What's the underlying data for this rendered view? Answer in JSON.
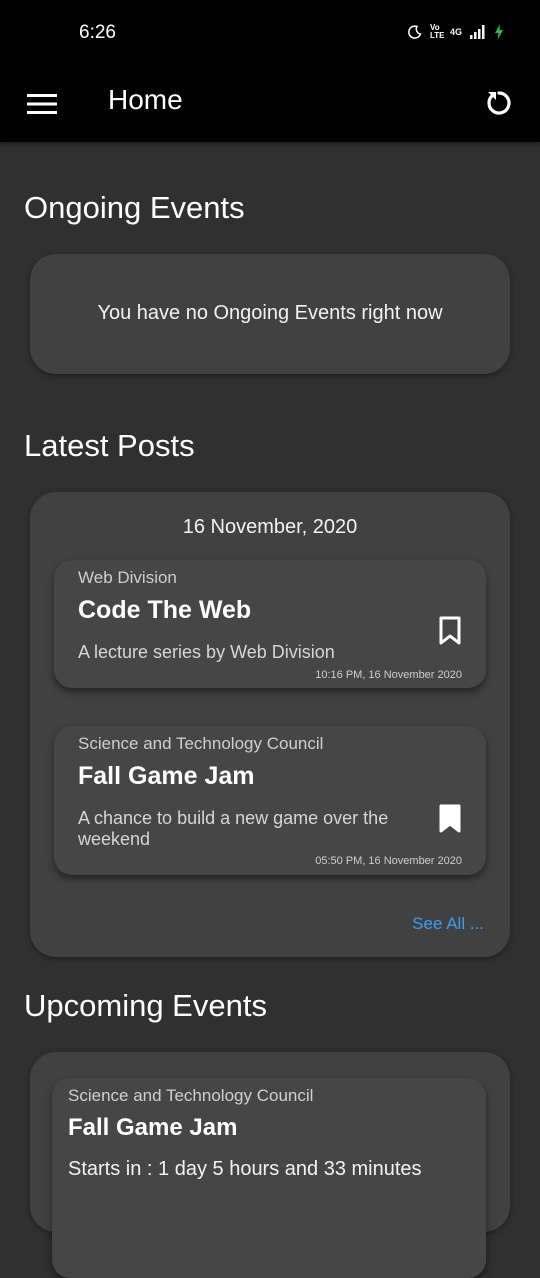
{
  "status_bar": {
    "time": "6:26",
    "network_label": "4G",
    "volte_label": "Vo LTE"
  },
  "app_bar": {
    "title": "Home",
    "menu_icon": "hamburger-menu-icon",
    "refresh_icon": "refresh-icon"
  },
  "ongoing": {
    "heading": "Ongoing Events",
    "empty_message": "You have no Ongoing Events right now"
  },
  "latest_posts": {
    "heading": "Latest Posts",
    "date": "16 November, 2020",
    "posts": [
      {
        "org": "Web Division",
        "title": "Code The Web",
        "description": "A lecture series by Web Division",
        "time": "10:16 PM, 16 November 2020",
        "bookmarked": false
      },
      {
        "org": "Science and Technology Council",
        "title": "Fall Game Jam",
        "description": "A chance to build a new game over the weekend",
        "time": "05:50 PM, 16 November 2020",
        "bookmarked": true
      }
    ],
    "see_all": "See All ..."
  },
  "upcoming": {
    "heading": "Upcoming Events",
    "events": [
      {
        "org": "Science and Technology Council",
        "title": "Fall Game Jam",
        "starts_in": "Starts in :  1 day 5 hours and 33 minutes"
      }
    ]
  },
  "colors": {
    "app_bar": "#000000",
    "background": "#303030",
    "card": "#414141",
    "link": "#3d9cf0"
  }
}
